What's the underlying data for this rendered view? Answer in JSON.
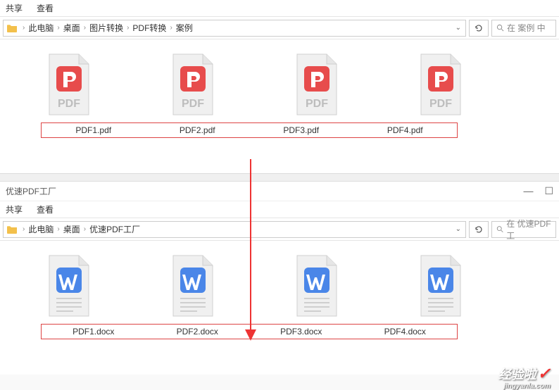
{
  "top_window": {
    "tabs": {
      "t1": "共享",
      "t2": "查看"
    },
    "breadcrumb": [
      "此电脑",
      "桌面",
      "图片转换",
      "PDF转换",
      "案例"
    ],
    "search_placeholder": "在 案例 中",
    "files": [
      {
        "name": "PDF1.pdf"
      },
      {
        "name": "PDF2.pdf"
      },
      {
        "name": "PDF3.pdf"
      },
      {
        "name": "PDF4.pdf"
      }
    ]
  },
  "bottom_window": {
    "title": "优速PDF工厂",
    "tabs": {
      "t1": "共享",
      "t2": "查看"
    },
    "breadcrumb": [
      "此电脑",
      "桌面",
      "优速PDF工厂"
    ],
    "search_placeholder": "在 优速PDF工",
    "files": [
      {
        "name": "PDF1.docx"
      },
      {
        "name": "PDF2.docx"
      },
      {
        "name": "PDF3.docx"
      },
      {
        "name": "PDF4.docx"
      }
    ]
  },
  "watermark": {
    "cn": "经验啦",
    "domain": "jingyanla.com"
  },
  "icons": {
    "pdf_color": "#e74c4c",
    "docx_color": "#4a86e8",
    "paper_color": "#f0f0f0",
    "paper_stroke": "#cfcfcf",
    "pdf_text": "PDF"
  }
}
